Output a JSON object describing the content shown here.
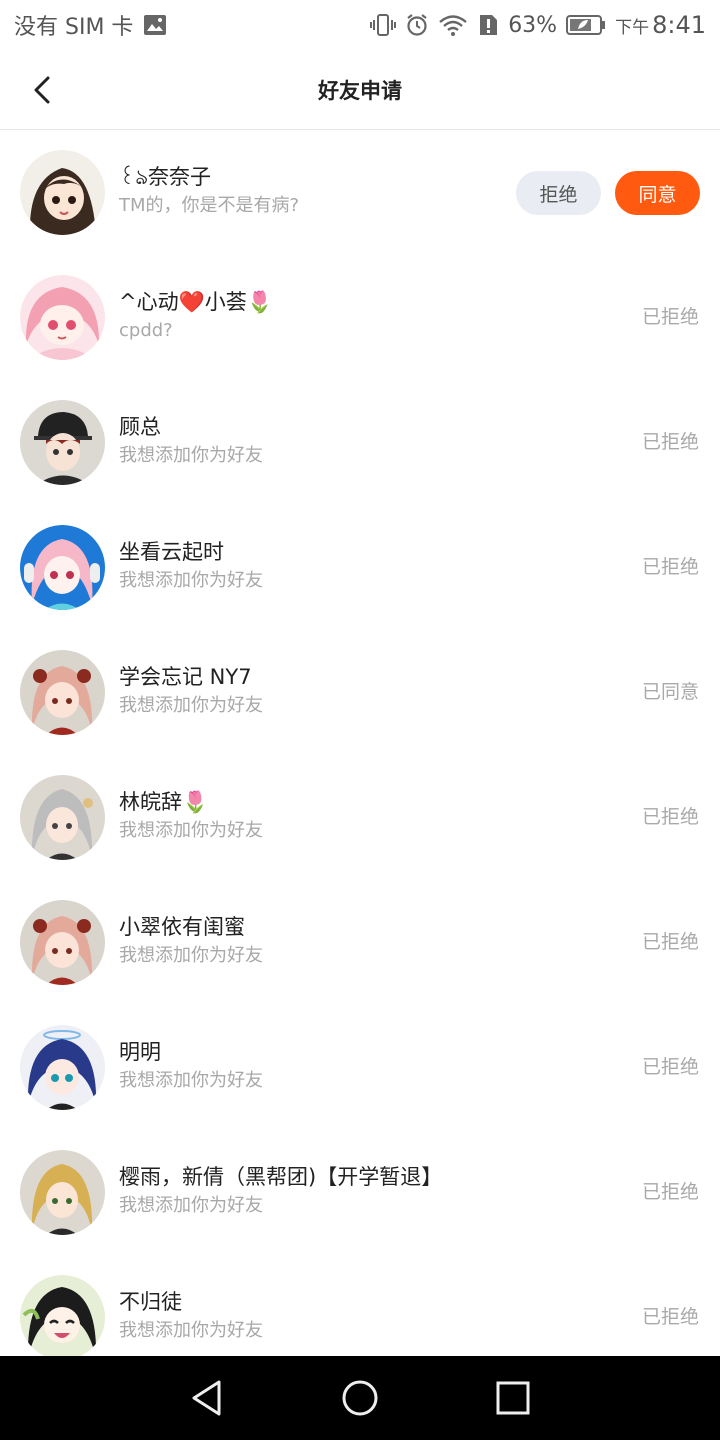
{
  "status_bar": {
    "carrier": "没有 SIM 卡",
    "battery": "63%",
    "time_prefix": "下午",
    "time": "8:41",
    "icons": [
      "image-icon",
      "vibrate-icon",
      "alarm-icon",
      "wifi-icon",
      "alert-icon",
      "battery-icon"
    ]
  },
  "header": {
    "title": "好友申请",
    "back_icon": "chevron-left-icon"
  },
  "first_request": {
    "reject_label": "拒绝",
    "accept_label": "同意"
  },
  "requests": [
    {
      "name": "꒰ঌ奈奈子",
      "message": "TM的，你是不是有病?",
      "status": ""
    },
    {
      "name": "^心动❤️小荟🌷",
      "message": "cpdd?",
      "status": "已拒绝"
    },
    {
      "name": "顾总",
      "message": "我想添加你为好友",
      "status": "已拒绝"
    },
    {
      "name": "坐看云起时",
      "message": "我想添加你为好友",
      "status": "已拒绝"
    },
    {
      "name": "学会忘记 NY7",
      "message": "我想添加你为好友",
      "status": "已同意"
    },
    {
      "name": "林皖辞🌷",
      "message": "我想添加你为好友",
      "status": "已拒绝"
    },
    {
      "name": "小翠依有闺蜜",
      "message": "我想添加你为好友",
      "status": "已拒绝"
    },
    {
      "name": "明明",
      "message": "我想添加你为好友",
      "status": "已拒绝"
    },
    {
      "name": "樱雨，新倩（黑帮团)【开学暂退】",
      "message": "我想添加你为好友",
      "status": "已拒绝"
    },
    {
      "name": "不归徒",
      "message": "我想添加你为好友",
      "status": "已拒绝"
    }
  ],
  "colors": {
    "accent": "#ff5a0f",
    "reject_bg": "#e9edf3",
    "muted_text": "#a8a8a8"
  },
  "nav_bar": {
    "icons": [
      "back-triangle-icon",
      "home-circle-icon",
      "recents-square-icon"
    ]
  }
}
